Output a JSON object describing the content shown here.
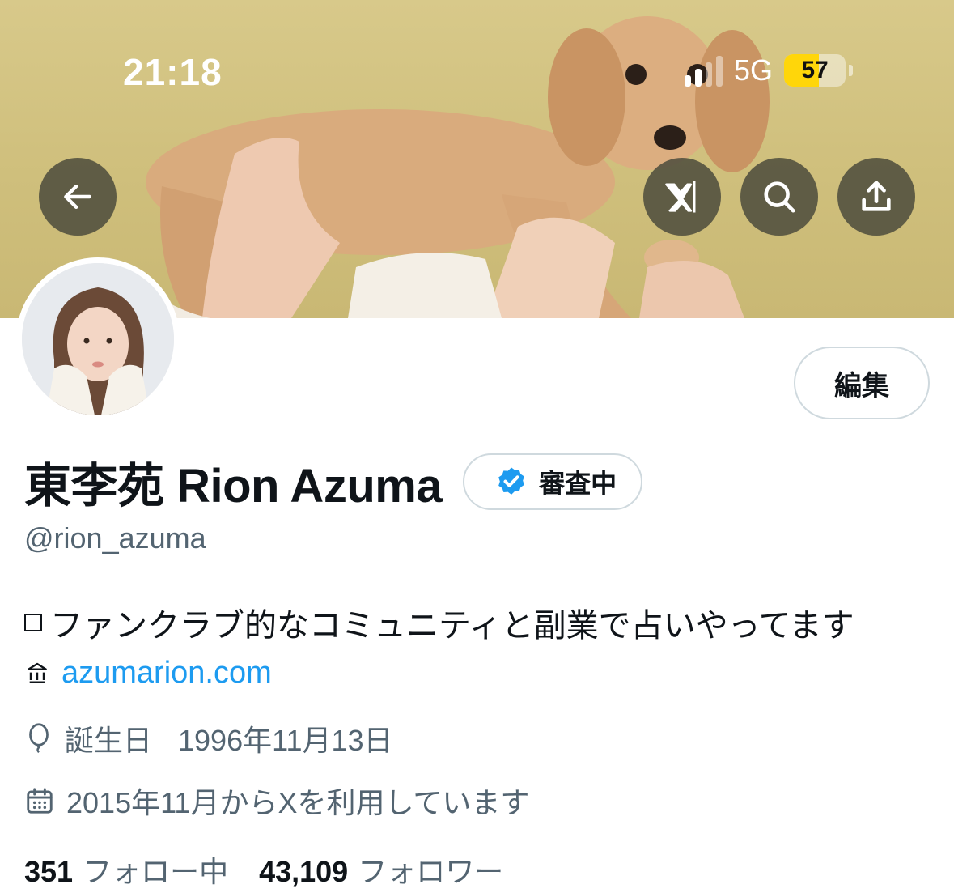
{
  "status_bar": {
    "time": "21:18",
    "network": "5G",
    "battery": "57",
    "battery_level": 0.57
  },
  "header": {
    "back_icon": "arrow-left-icon",
    "grok_icon": "grok-icon",
    "search_icon": "search-icon",
    "share_icon": "share-icon"
  },
  "profile": {
    "edit_label": "編集",
    "name": "東李苑  Rion Azuma",
    "verification_label": "審査中",
    "handle": "@rion_azuma",
    "bio": "ファンクラブ的なコミュニティと副業で占いやってます",
    "website": "azumarion.com",
    "birthday_label": "誕生日",
    "birthday": "1996年11月13日",
    "joined": "2015年11月からXを利用しています",
    "following_count": "351",
    "following_label": "フォロー中",
    "followers_count": "43,109",
    "followers_label": "フォロワー"
  },
  "colors": {
    "link": "#1d9bf0",
    "verified": "#1d9bf0",
    "secondary_text": "#536471",
    "battery": "#ffd60a"
  }
}
